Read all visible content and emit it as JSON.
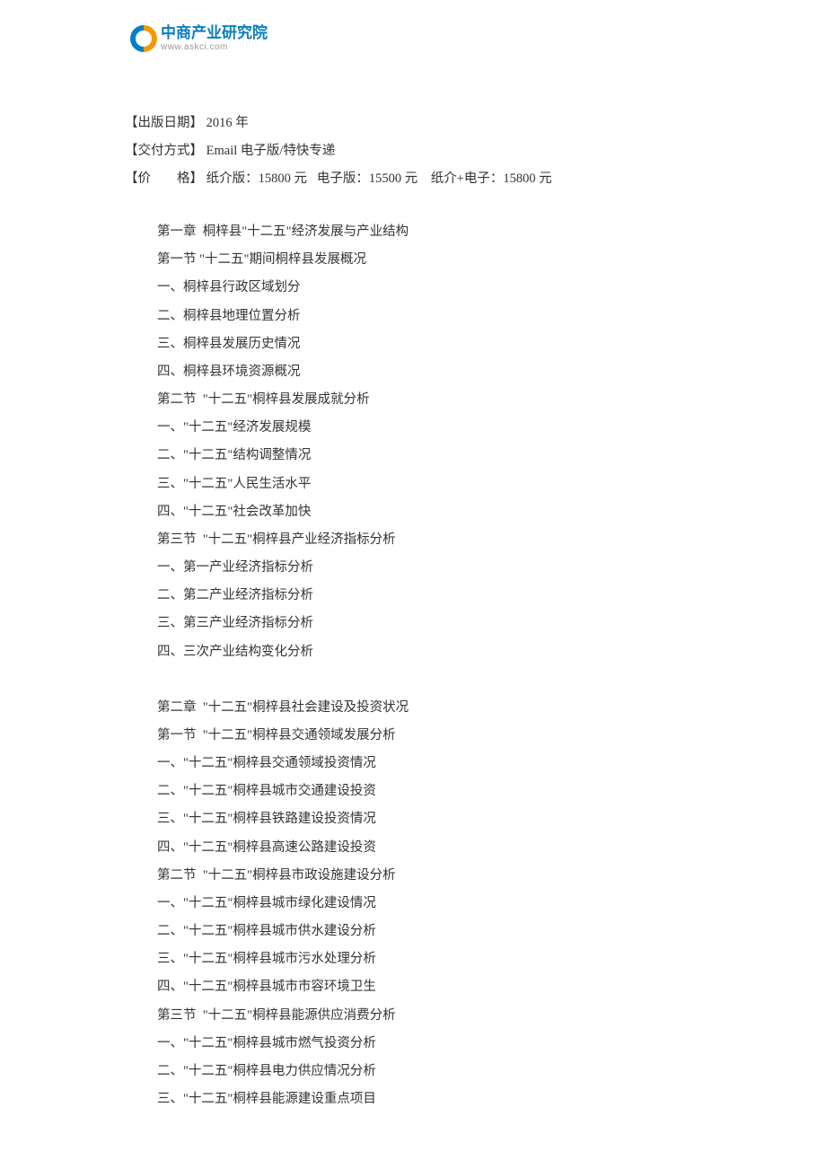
{
  "logo": {
    "cn": "中商产业研究院",
    "url": "www.askci.com"
  },
  "meta": {
    "pub_label": "【出版日期】 ",
    "pub_value": "2016 年",
    "delivery_label": "【交付方式】 ",
    "delivery_value": "Email 电子版/特快专递",
    "price_label": "【价        格】 ",
    "price_value": "纸介版：15800 元   电子版：15500 元    纸介+电子：15800 元"
  },
  "toc": {
    "lines_a": [
      "第一章  桐梓县\"十二五\"经济发展与产业结构",
      "第一节 \"十二五\"期间桐梓县发展概况",
      "一、桐梓县行政区域划分",
      "二、桐梓县地理位置分析",
      "三、桐梓县发展历史情况",
      "四、桐梓县环境资源概况",
      "第二节  \"十二五\"桐梓县发展成就分析",
      "一、\"十二五\"经济发展规模",
      "二、\"十二五\"结构调整情况",
      "三、\"十二五\"人民生活水平",
      "四、\"十二五\"社会改革加快",
      "第三节  \"十二五\"桐梓县产业经济指标分析",
      "一、第一产业经济指标分析",
      "二、第二产业经济指标分析",
      "三、第三产业经济指标分析",
      "四、三次产业结构变化分析"
    ],
    "lines_b": [
      "第二章  \"十二五\"桐梓县社会建设及投资状况",
      "第一节  \"十二五\"桐梓县交通领域发展分析",
      "一、\"十二五\"桐梓县交通领域投资情况",
      "二、\"十二五\"桐梓县城市交通建设投资",
      "三、\"十二五\"桐梓县铁路建设投资情况",
      "四、\"十二五\"桐梓县高速公路建设投资",
      "第二节  \"十二五\"桐梓县市政设施建设分析",
      "一、\"十二五\"桐梓县城市绿化建设情况",
      "二、\"十二五\"桐梓县城市供水建设分析",
      "三、\"十二五\"桐梓县城市污水处理分析",
      "四、\"十二五\"桐梓县城市市容环境卫生",
      "第三节  \"十二五\"桐梓县能源供应消费分析",
      "一、\"十二五\"桐梓县城市燃气投资分析",
      "二、\"十二五\"桐梓县电力供应情况分析",
      "三、\"十二五\"桐梓县能源建设重点项目"
    ]
  }
}
